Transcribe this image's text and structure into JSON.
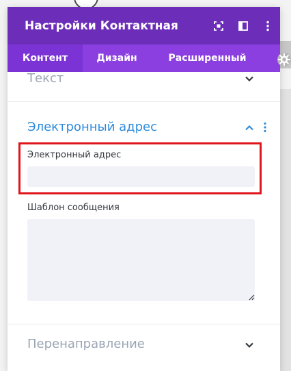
{
  "window": {
    "title": "Настройки Контактная ф…"
  },
  "header_icons": [
    "expand-icon",
    "sidebar-layout-icon",
    "more-vertical-icon"
  ],
  "tabs": [
    {
      "label": "Контент",
      "active": true
    },
    {
      "label": "Дизайн",
      "active": false
    },
    {
      "label": "Расширенный",
      "active": false
    }
  ],
  "sections": {
    "text": {
      "title": "Текст"
    },
    "email": {
      "title": "Электронный адрес",
      "fields": {
        "email_address": {
          "label": "Электронный адрес",
          "value": ""
        },
        "message_template": {
          "label": "Шаблон сообщения",
          "value": ""
        }
      }
    },
    "redirect": {
      "title": "Перенаправление"
    }
  },
  "colors": {
    "header": "#6c2eb9",
    "tabs": "#8b3fe0",
    "active_tab": "#7b33d6",
    "section_open": "#2e8bdb",
    "section_closed": "#9aa5b4",
    "highlight": "#e0141b"
  }
}
